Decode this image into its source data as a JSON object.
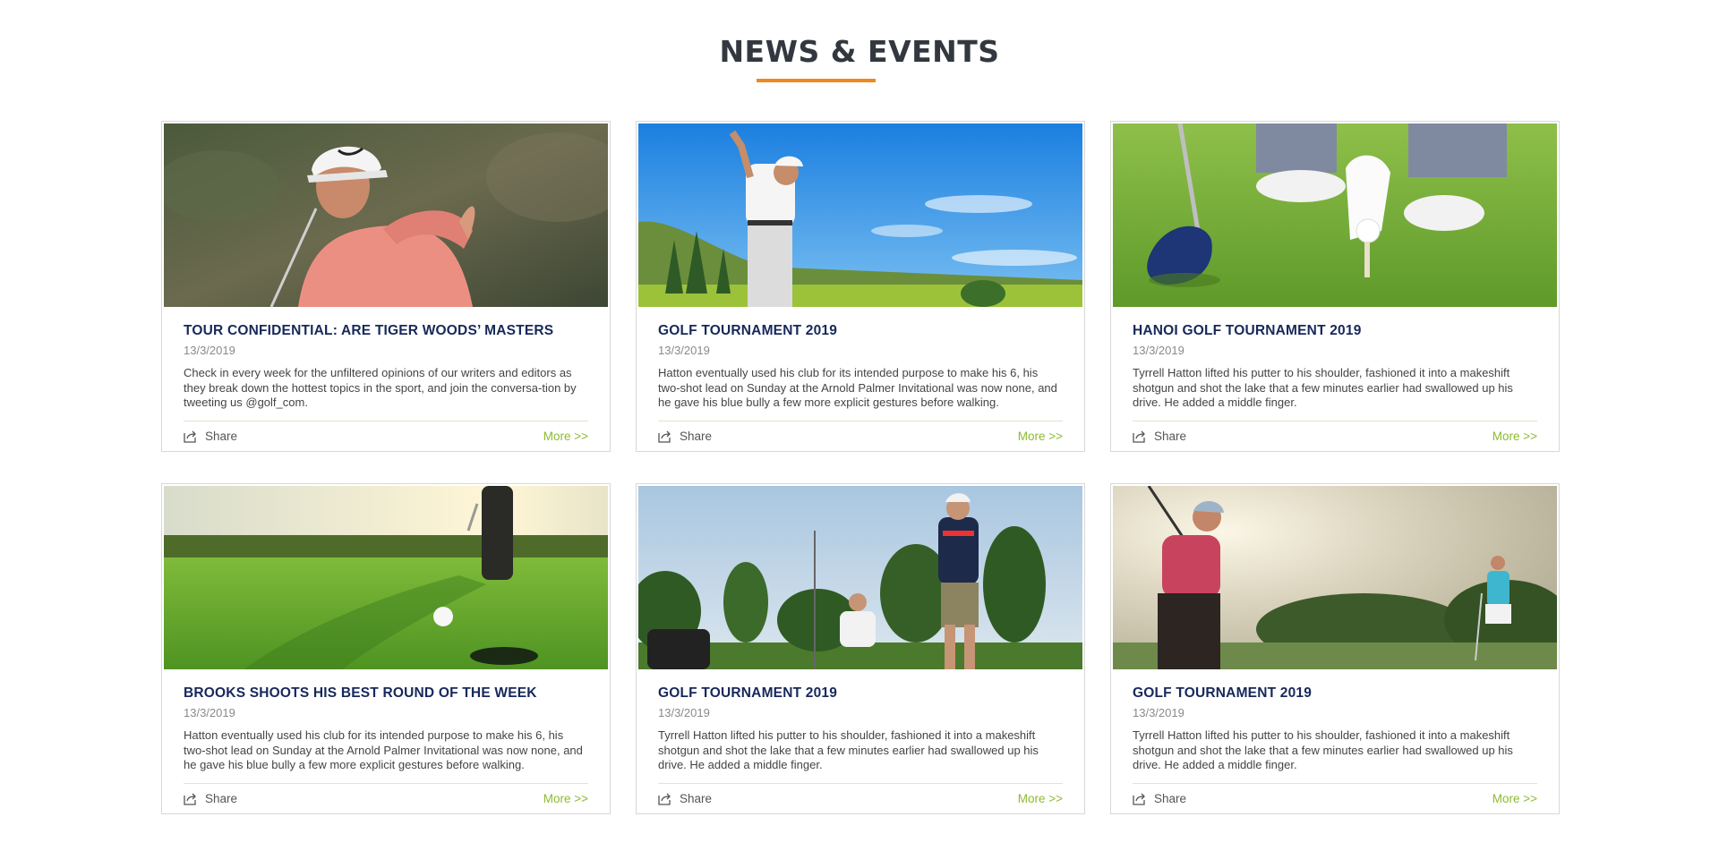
{
  "section": {
    "title": "NEWS & EVENTS",
    "accent_color": "#ec8a1f"
  },
  "cards": [
    {
      "image": "golfer-in-pink-shirt-photo",
      "title": "TOUR CONFIDENTIAL: ARE TIGER WOODS’ MASTERS",
      "date": "13/3/2019",
      "excerpt": "Check in every week for the unfiltered opinions of our writers and editors as they break down the hottest topics in the sport, and join the conversa-tion by tweeting us @golf_com.",
      "share_label": "Share",
      "more_label": "More >>"
    },
    {
      "image": "golfer-swing-blue-sky-photo",
      "title": "GOLF TOURNAMENT 2019",
      "date": "13/3/2019",
      "excerpt": "Hatton eventually used his club for its intended purpose to make his 6, his two-shot lead on Sunday at the Arnold Palmer Invitational was now none, and he gave his blue bully a few more explicit gestures before walking.",
      "share_label": "Share",
      "more_label": "More >>"
    },
    {
      "image": "golf-ball-on-tee-photo",
      "title": "HANOI GOLF TOURNAMENT 2019",
      "date": "13/3/2019",
      "excerpt": "Tyrrell Hatton lifted his putter to his shoulder, fashioned it into a makeshift shotgun and shot the lake that a few minutes earlier had swallowed up his drive. He added a middle finger.",
      "share_label": "Share",
      "more_label": "More >>"
    },
    {
      "image": "putting-green-sunset-photo",
      "title": "BROOKS SHOOTS HIS BEST ROUND OF THE WEEK",
      "date": "13/3/2019",
      "excerpt": "Hatton eventually used his club for its intended purpose to make his 6, his two-shot lead on Sunday at the Arnold Palmer Invitational was now none, and he gave his blue bully a few more explicit gestures before walking.",
      "share_label": "Share",
      "more_label": "More >>"
    },
    {
      "image": "golfers-with-trees-photo",
      "title": "GOLF TOURNAMENT 2019",
      "date": "13/3/2019",
      "excerpt": "Tyrrell Hatton lifted his putter to his shoulder, fashioned it into a makeshift shotgun and shot the lake that a few minutes earlier had swallowed up his drive. He added a middle finger.",
      "share_label": "Share",
      "more_label": "More >>"
    },
    {
      "image": "golf-couple-sunlight-photo",
      "title": "GOLF TOURNAMENT 2019",
      "date": "13/3/2019",
      "excerpt": "Tyrrell Hatton lifted his putter to his shoulder, fashioned it into a makeshift shotgun and shot the lake that a few minutes earlier had swallowed up his drive. He added a middle finger.",
      "share_label": "Share",
      "more_label": "More >>"
    }
  ],
  "colors": {
    "title_navy": "#17285a",
    "more_green": "#8dbb2f"
  }
}
